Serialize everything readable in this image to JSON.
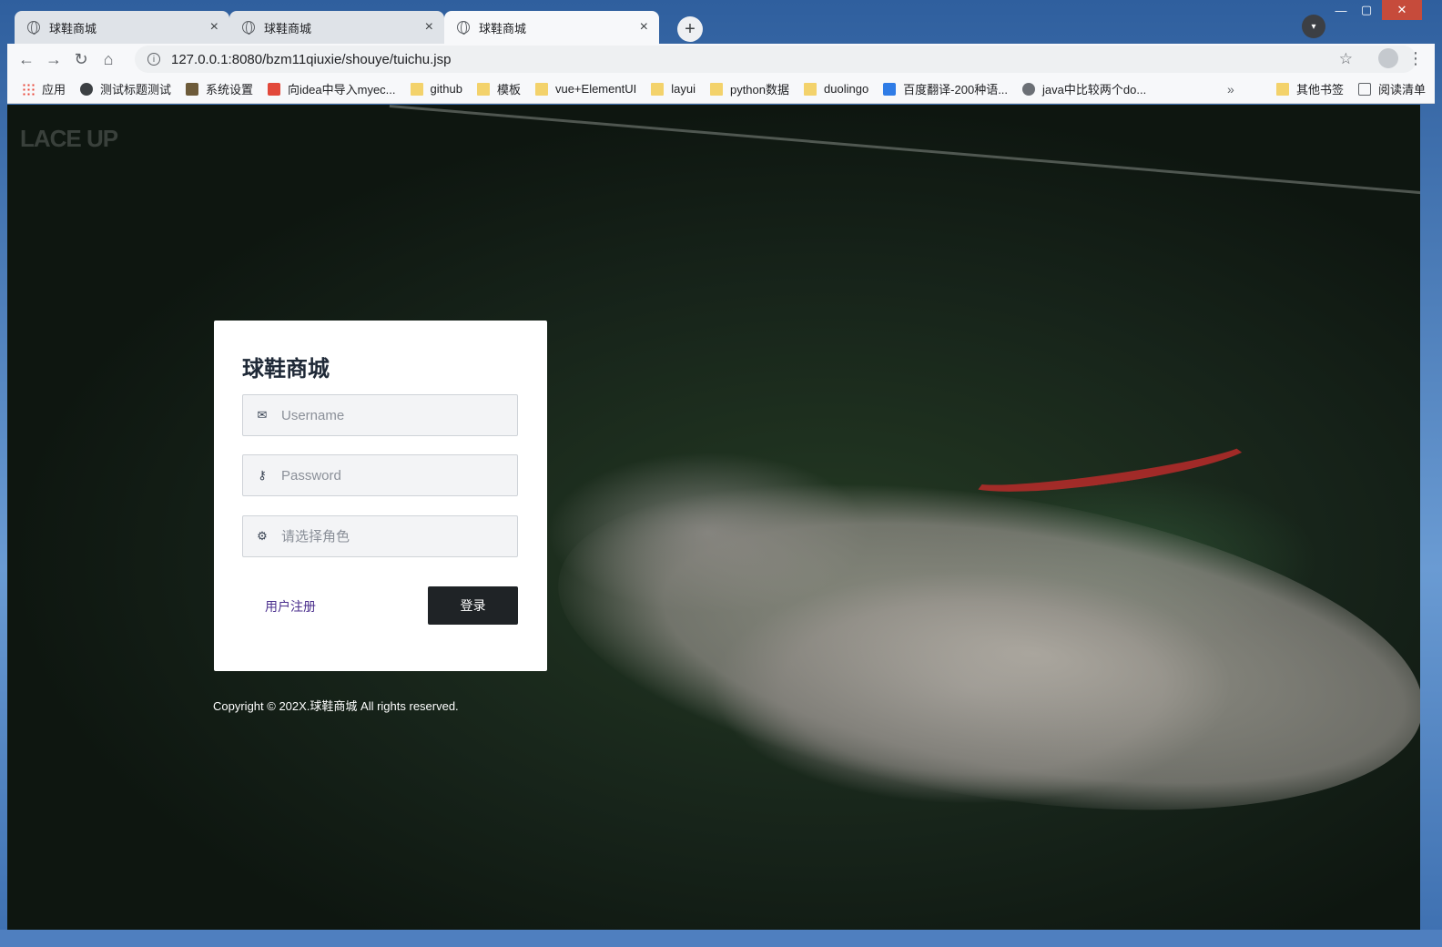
{
  "browser": {
    "tabs": [
      {
        "title": "球鞋商城",
        "close": "×"
      },
      {
        "title": "球鞋商城",
        "close": "×"
      },
      {
        "title": "球鞋商城",
        "close": "×"
      }
    ],
    "new_tab": "+",
    "url": "127.0.0.1:8080/bzm11qiuxie/shouye/tuichu.jsp",
    "nav": {
      "back": "←",
      "forward": "→",
      "reload": "↻",
      "home": "⌂",
      "info": "i",
      "star": "☆",
      "menu": "⋮"
    },
    "window_controls": {
      "minimize": "—",
      "maximize": "▢",
      "close": "✕"
    }
  },
  "bookmarks": {
    "items": [
      {
        "label": "应用",
        "icon": "apps-grid-icon"
      },
      {
        "label": "测试标题测试",
        "icon": "globe-icon"
      },
      {
        "label": "系统设置",
        "icon": "image-icon"
      },
      {
        "label": "向idea中导入myec...",
        "icon": "csdn-icon"
      },
      {
        "label": "github",
        "icon": "folder-icon"
      },
      {
        "label": "模板",
        "icon": "folder-icon"
      },
      {
        "label": "vue+ElementUI",
        "icon": "folder-icon"
      },
      {
        "label": "layui",
        "icon": "folder-icon"
      },
      {
        "label": "python数据",
        "icon": "folder-icon"
      },
      {
        "label": "duolingo",
        "icon": "folder-icon"
      },
      {
        "label": "百度翻译-200种语...",
        "icon": "translate-icon"
      },
      {
        "label": "java中比较两个do...",
        "icon": "link-icon"
      }
    ],
    "overflow": "»",
    "other": "其他书签",
    "reading_list": "阅读清单"
  },
  "page": {
    "logo": "LACE UP",
    "login": {
      "title": "球鞋商城",
      "username_placeholder": "Username",
      "password_placeholder": "Password",
      "role_placeholder": "请选择角色",
      "register_label": "用户注册",
      "login_label": "登录"
    },
    "copyright": "Copyright © 202X.球鞋商城 All rights reserved."
  }
}
